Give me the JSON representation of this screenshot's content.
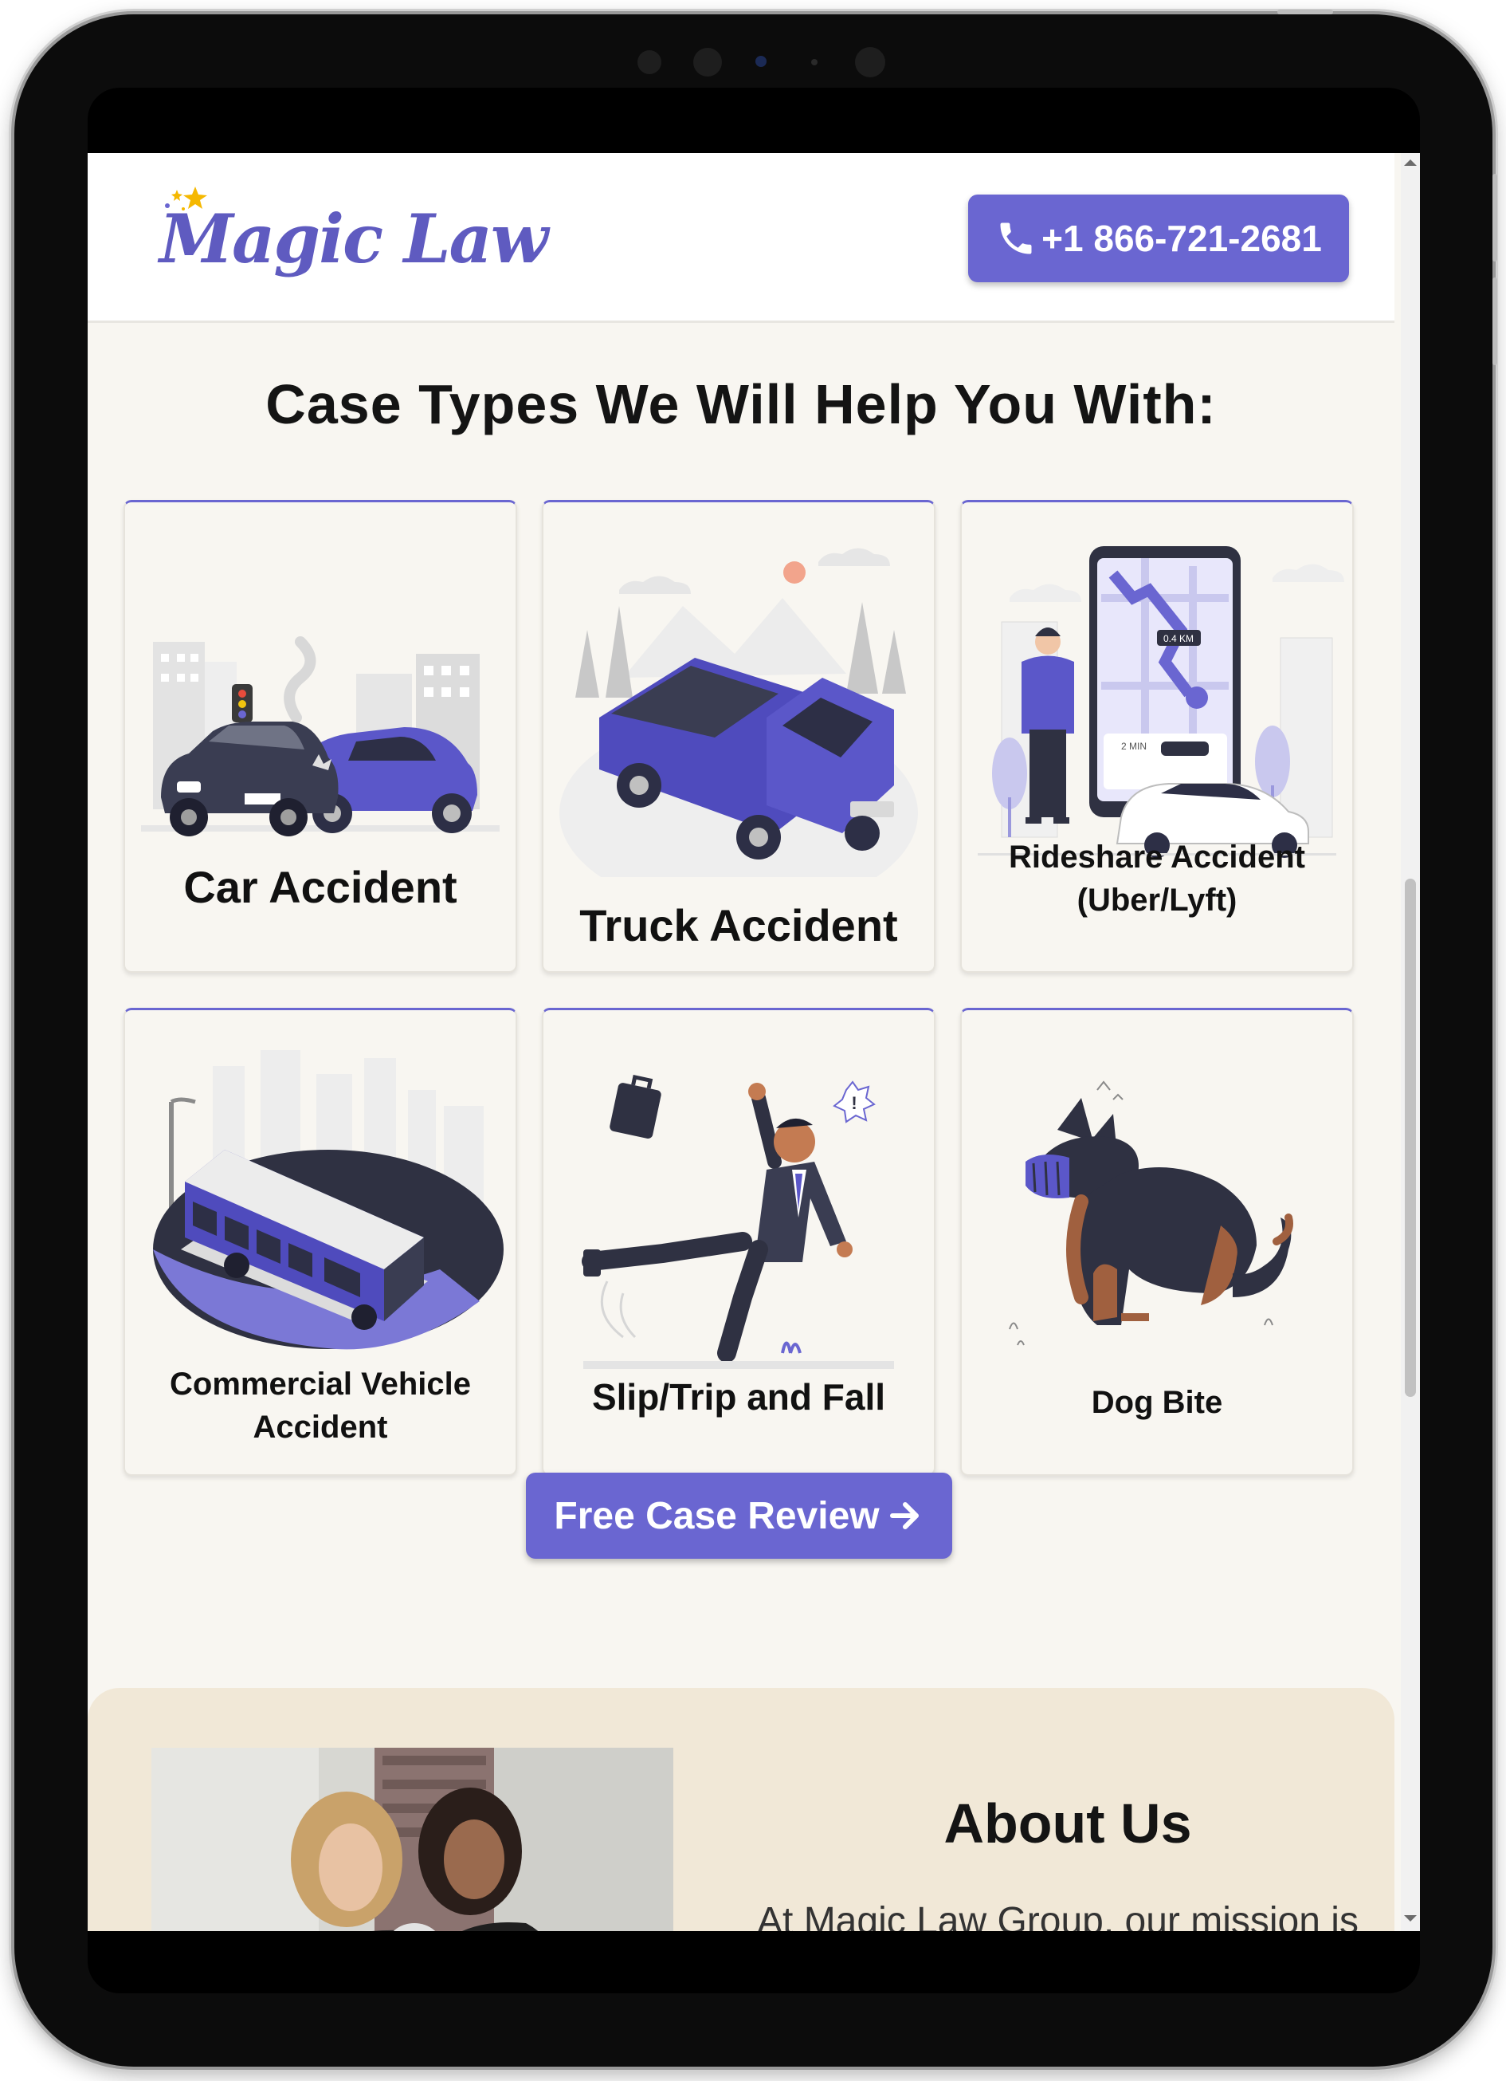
{
  "brand": {
    "name": "Magic Law",
    "accent": "#6a66d1"
  },
  "header": {
    "phone": "+1 866-721-2681"
  },
  "cases": {
    "title": "Case Types We Will Help You With:",
    "items": [
      {
        "label": "Car Accident",
        "icon": "car-accident-illustration"
      },
      {
        "label": "Truck Accident",
        "icon": "truck-accident-illustration"
      },
      {
        "label": "Rideshare Accident (Uber/Lyft)",
        "icon": "rideshare-illustration",
        "map_distance": "0.4 KM",
        "map_time": "2 MIN"
      },
      {
        "label": "Commercial Vehicle Accident",
        "icon": "bus-illustration"
      },
      {
        "label": "Slip/Trip and Fall",
        "icon": "slip-fall-illustration"
      },
      {
        "label": "Dog Bite",
        "icon": "dog-illustration"
      }
    ]
  },
  "cta": {
    "label": "Free Case Review"
  },
  "about": {
    "title": "About Us",
    "text": "At Magic Law Group, our mission is"
  }
}
